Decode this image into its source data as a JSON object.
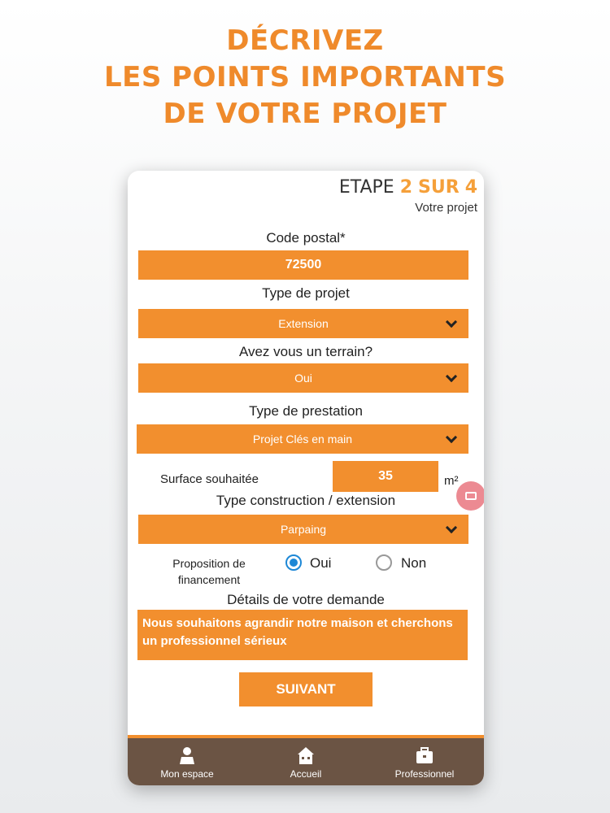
{
  "headline": [
    "DÉCRIVEZ",
    "LES POINTS IMPORTANTS",
    "DE VOTRE PROJET"
  ],
  "step": {
    "prefix": "ETAPE",
    "current": "2",
    "sep": "SUR",
    "total": "4",
    "subtitle": "Votre projet"
  },
  "form": {
    "postal_label": "Code postal*",
    "postal_value": "72500",
    "project_type_label": "Type de projet",
    "project_type_value": "Extension",
    "terrain_label": "Avez vous un terrain?",
    "terrain_value": "Oui",
    "prestation_label": "Type de prestation",
    "prestation_value": "Projet Clés en main",
    "surface_label": "Surface souhaitée",
    "surface_value": "35",
    "surface_unit": "m²",
    "construction_label": "Type construction / extension",
    "construction_value": "Parpaing",
    "financing_label_1": "Proposition de",
    "financing_label_2": "financement",
    "financing_yes": "Oui",
    "financing_no": "Non",
    "details_label": "Détails de votre demande",
    "details_value": "Nous souhaitons agrandir notre maison et chercho​ns un professionnel sérieux",
    "submit_label": "SUIVANT"
  },
  "tabbar": [
    {
      "label": "Mon espace",
      "icon": "user-icon"
    },
    {
      "label": "Accueil",
      "icon": "house-icon"
    },
    {
      "label": "Professionnel",
      "icon": "briefcase-icon"
    }
  ],
  "colors": {
    "accent": "#f28f2e",
    "tabbar": "#6b5444",
    "radio": "#1e88d6"
  }
}
